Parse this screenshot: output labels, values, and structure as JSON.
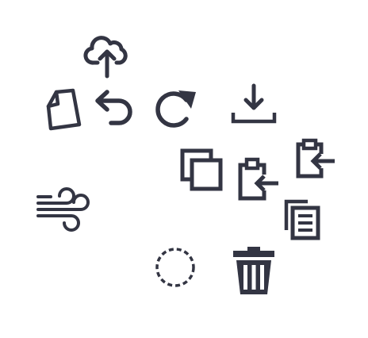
{
  "toolbar": {
    "icon_color": "#333543",
    "icons": [
      {
        "id": "upload",
        "icon": "cloud-upload-icon"
      },
      {
        "id": "new-file",
        "icon": "file-icon"
      },
      {
        "id": "undo",
        "icon": "undo-icon"
      },
      {
        "id": "redo",
        "icon": "redo-icon"
      },
      {
        "id": "download",
        "icon": "download-icon"
      },
      {
        "id": "paste-in",
        "icon": "clipboard-paste-icon"
      },
      {
        "id": "copy",
        "icon": "copy-icon"
      },
      {
        "id": "paste",
        "icon": "clipboard-paste-icon"
      },
      {
        "id": "wind",
        "icon": "wind-icon"
      },
      {
        "id": "duplicate",
        "icon": "duplicate-pages-icon"
      },
      {
        "id": "select",
        "icon": "dashed-circle-select-icon"
      },
      {
        "id": "delete",
        "icon": "trash-icon"
      }
    ]
  }
}
